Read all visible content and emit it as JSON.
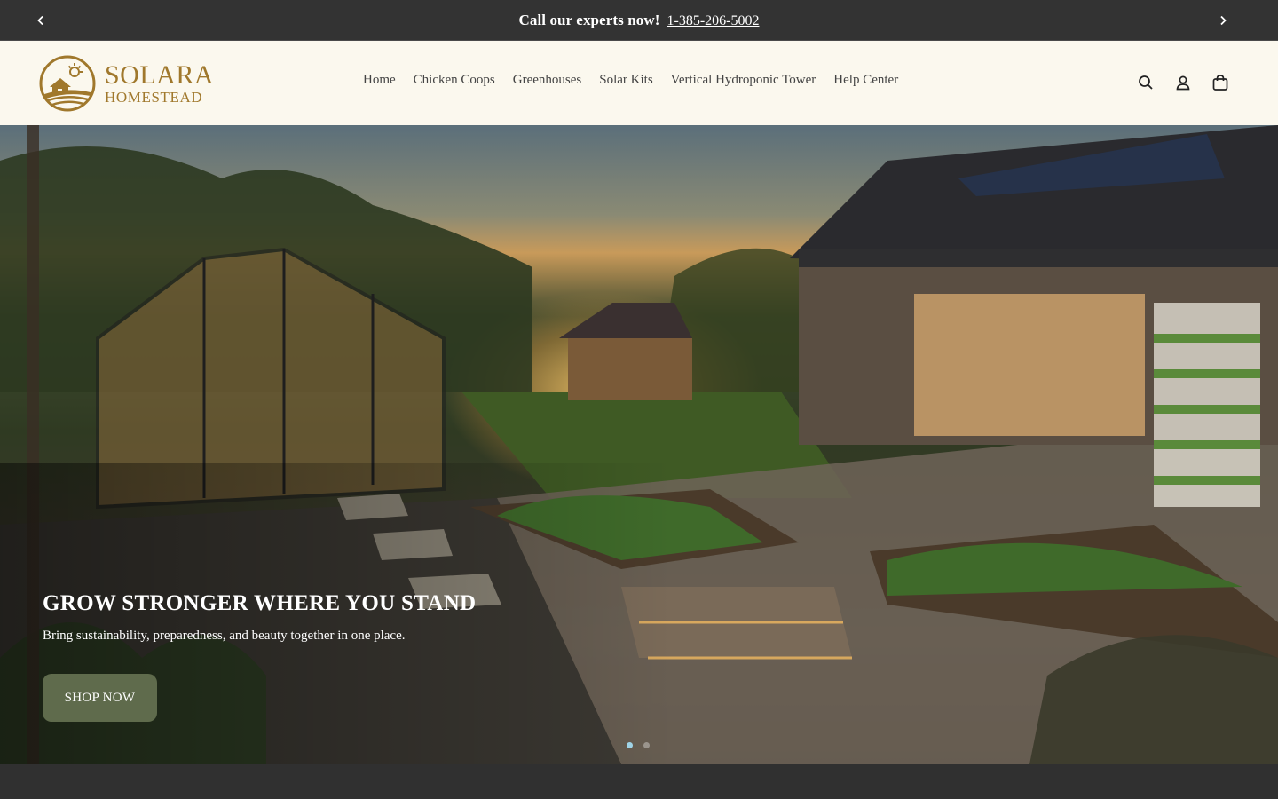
{
  "announcement": {
    "message": "Call our experts now!",
    "phone": "1-385-206-5002",
    "prev_icon": "chevron-left-icon",
    "next_icon": "chevron-right-icon"
  },
  "brand": {
    "name_line1": "SOLARA",
    "name_line2": "HOMESTEAD",
    "color": "#a0782c"
  },
  "nav": {
    "items": [
      "Home",
      "Chicken Coops",
      "Greenhouses",
      "Solar Kits",
      "Vertical Hydroponic Tower",
      "Help Center"
    ]
  },
  "header_icons": [
    "search-icon",
    "account-icon",
    "cart-icon"
  ],
  "hero": {
    "title": "GROW STRONGER WHERE YOU STAND",
    "subtitle": "Bring sustainability, preparedness, and beauty together in one place.",
    "cta_label": "SHOP NOW",
    "cta_color": "#5f6b4c",
    "slides_total": 2,
    "active_slide": 1
  }
}
